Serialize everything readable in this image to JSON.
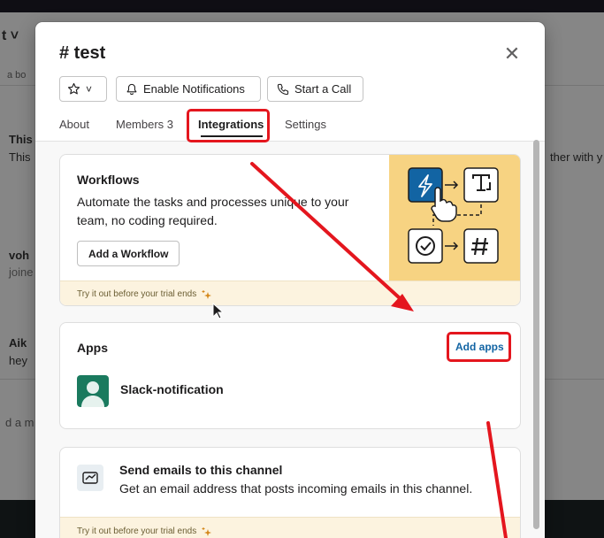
{
  "background": {
    "top_left_text": "t ˅",
    "hint_text": "a bo",
    "msg1_name": "This",
    "msg1_body": "This",
    "msg1_trailing": "ther with y",
    "msg2_name": "voh",
    "msg2_body": "joine",
    "msg3_name": "Aik",
    "msg3_body": "hey",
    "composer_hint": "d a m"
  },
  "modal": {
    "title": "# test",
    "close_label": "✕",
    "header_buttons": {
      "star_label": "˅",
      "notifications_label": "Enable Notifications",
      "call_label": "Start a Call"
    },
    "tabs": [
      {
        "label": "About"
      },
      {
        "label": "Members 3"
      },
      {
        "label": "Integrations"
      },
      {
        "label": "Settings"
      }
    ],
    "active_tab": "Integrations",
    "workflows": {
      "title": "Workflows",
      "description": "Automate the tasks and processes unique to your team, no coding required.",
      "button_label": "Add a Workflow",
      "trial_text": "Try it out before your trial ends"
    },
    "apps": {
      "title": "Apps",
      "add_label": "Add apps",
      "items": [
        {
          "name": "Slack-notification"
        }
      ]
    },
    "email": {
      "title": "Send emails to this channel",
      "description": "Get an email address that posts incoming emails in this channel.",
      "trial_text": "Try it out before your trial ends"
    }
  },
  "colors": {
    "annotation_red": "#e4161e",
    "link_blue": "#1264a3",
    "illustration_yellow": "#f7d382",
    "workflow_tile_blue": "#1264a3",
    "app_green": "#1a7a5e"
  },
  "icons": [
    "star-icon",
    "bell-icon",
    "phone-icon",
    "close-icon",
    "lightning-icon",
    "text-icon",
    "check-icon",
    "hash-icon",
    "sparkle-icon",
    "email-icon",
    "pointer-hand-icon",
    "cursor-icon"
  ]
}
